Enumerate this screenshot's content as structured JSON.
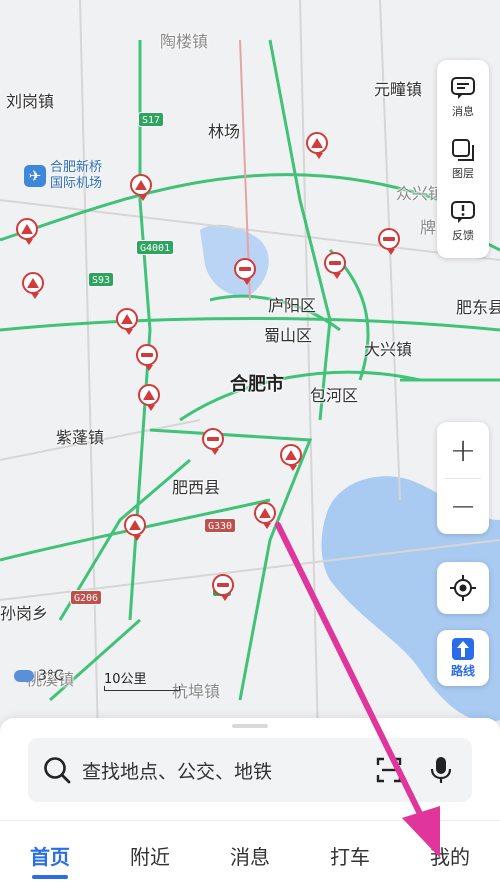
{
  "map": {
    "places": [
      {
        "id": "lgz",
        "label": "刘岗镇"
      },
      {
        "id": "ytz",
        "label": "元疃镇"
      },
      {
        "id": "lc",
        "label": "林场"
      },
      {
        "id": "lyq",
        "label": "庐阳区"
      },
      {
        "id": "ssq",
        "label": "蜀山区"
      },
      {
        "id": "hfs",
        "label": "合肥市"
      },
      {
        "id": "bhq",
        "label": "包河区"
      },
      {
        "id": "dxz",
        "label": "大兴镇"
      },
      {
        "id": "zpz",
        "label": "紫蓬镇"
      },
      {
        "id": "fxx",
        "label": "肥西县"
      },
      {
        "id": "fdx",
        "label": "肥东县"
      },
      {
        "id": "xgx",
        "label": "孙岗乡"
      },
      {
        "id": "hbz",
        "label": "杭埠镇"
      },
      {
        "id": "qxz",
        "label": "众兴镇"
      },
      {
        "id": "ldz",
        "label": "陶楼镇"
      },
      {
        "id": "pm",
        "label": "牌"
      },
      {
        "id": "tqz",
        "label": "桃溪镇"
      }
    ],
    "airport_label": "合肥新桥\n国际机场",
    "shields": [
      {
        "id": "s17",
        "label": "S17"
      },
      {
        "id": "g4001",
        "label": "G4001"
      },
      {
        "id": "s93",
        "label": "S93"
      },
      {
        "id": "g330",
        "label": "G330"
      },
      {
        "id": "g206",
        "label": "G206"
      },
      {
        "id": "g3",
        "label": "G3"
      }
    ]
  },
  "side_panel": {
    "messages_label": "消息",
    "layers_label": "图层",
    "feedback_label": "反馈"
  },
  "zoom": {
    "in_label": "+",
    "out_label": "−"
  },
  "route": {
    "label": "路线"
  },
  "weather": {
    "temp": "3°C"
  },
  "scale": {
    "label": "10公里"
  },
  "search": {
    "placeholder": "查找地点、公交、地铁"
  },
  "tabs": [
    {
      "label": "首页"
    },
    {
      "label": "附近"
    },
    {
      "label": "消息"
    },
    {
      "label": "打车"
    },
    {
      "label": "我的"
    }
  ],
  "colors": {
    "accent": "#2b6de8",
    "road": "#2ebd6b",
    "alert": "#d23b3b",
    "water": "#a9cbf2",
    "annotation": "#e0359a"
  }
}
